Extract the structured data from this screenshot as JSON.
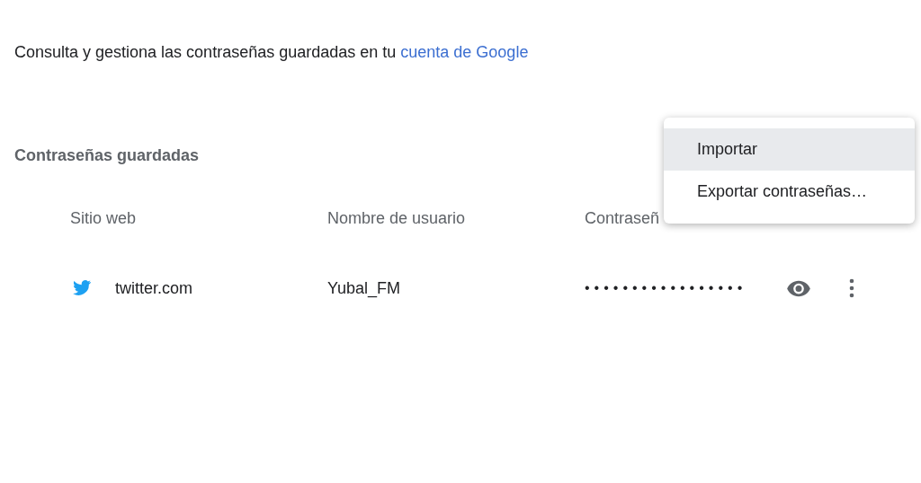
{
  "intro": {
    "text": "Consulta y gestiona las contraseñas guardadas en tu ",
    "link": "cuenta de Google"
  },
  "section_title": "Contraseñas guardadas",
  "table": {
    "columns": [
      "Sitio web",
      "Nombre de usuario",
      "Contraseñ"
    ],
    "rows": [
      {
        "site": "twitter.com",
        "username": "Yubal_FM",
        "password": "•••••••••••••••••"
      }
    ]
  },
  "menu": {
    "items": [
      {
        "label": "Importar",
        "selected": true
      },
      {
        "label": "Exportar contraseñas…",
        "selected": false
      }
    ]
  }
}
